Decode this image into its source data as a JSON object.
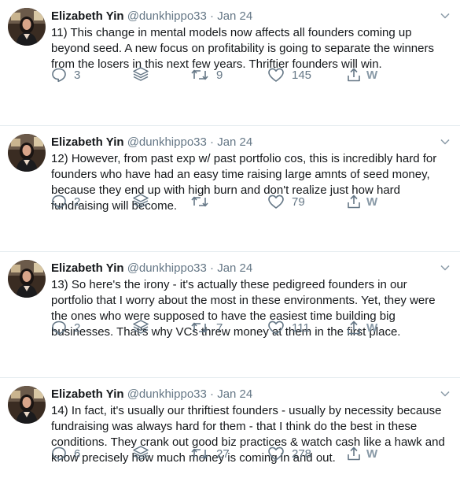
{
  "tweets": [
    {
      "author": "Elizabeth Yin",
      "handle": "@dunkhippo33",
      "separator": "·",
      "date": "Jan 24",
      "text": "11) This change in mental models now affects all founders coming up beyond seed. A new focus on profitability is going to separate the winners from the losers in this next few years. Thriftier founders will win.",
      "replies": "3",
      "retweets": "9",
      "likes": "145",
      "w_label": "W"
    },
    {
      "author": "Elizabeth Yin",
      "handle": "@dunkhippo33",
      "separator": "·",
      "date": "Jan 24",
      "text": "12) However, from past exp w/ past portfolio cos, this is incredibly hard for founders who have had an easy time raising large amnts of seed money, because they end up with high burn and don't realize just how hard fundraising will become.",
      "replies": "2",
      "retweets": "",
      "likes": "79",
      "w_label": "W"
    },
    {
      "author": "Elizabeth Yin",
      "handle": "@dunkhippo33",
      "separator": "·",
      "date": "Jan 24",
      "text": "13) So here's the irony - it's actually these pedigreed founders in our portfolio that I worry about the most in these environments. Yet, they were the ones who were supposed to have the easiest time building big businesses. That's why VCs threw money at them in the first place.",
      "replies": "2",
      "retweets": "7",
      "likes": "111",
      "w_label": "W"
    },
    {
      "author": "Elizabeth Yin",
      "handle": "@dunkhippo33",
      "separator": "·",
      "date": "Jan 24",
      "text": "14) In fact, it's usually our thriftiest founders - usually by necessity because fundraising was always hard for them - that I think do the best in these conditions. They crank out good biz practices & watch cash like a hawk and know precisely how much money is coming in and out.",
      "replies": "6",
      "retweets": "27",
      "likes": "278",
      "w_label": "W"
    }
  ],
  "icons": {
    "reply": "reply-icon",
    "stack": "layers-icon",
    "retweet": "retweet-icon",
    "like": "heart-icon",
    "share": "share-icon",
    "caret": "chevron-down-icon"
  },
  "colors": {
    "text": "#14171a",
    "muted": "#657786",
    "icon": "#657786",
    "divider": "#e6ecf0"
  }
}
